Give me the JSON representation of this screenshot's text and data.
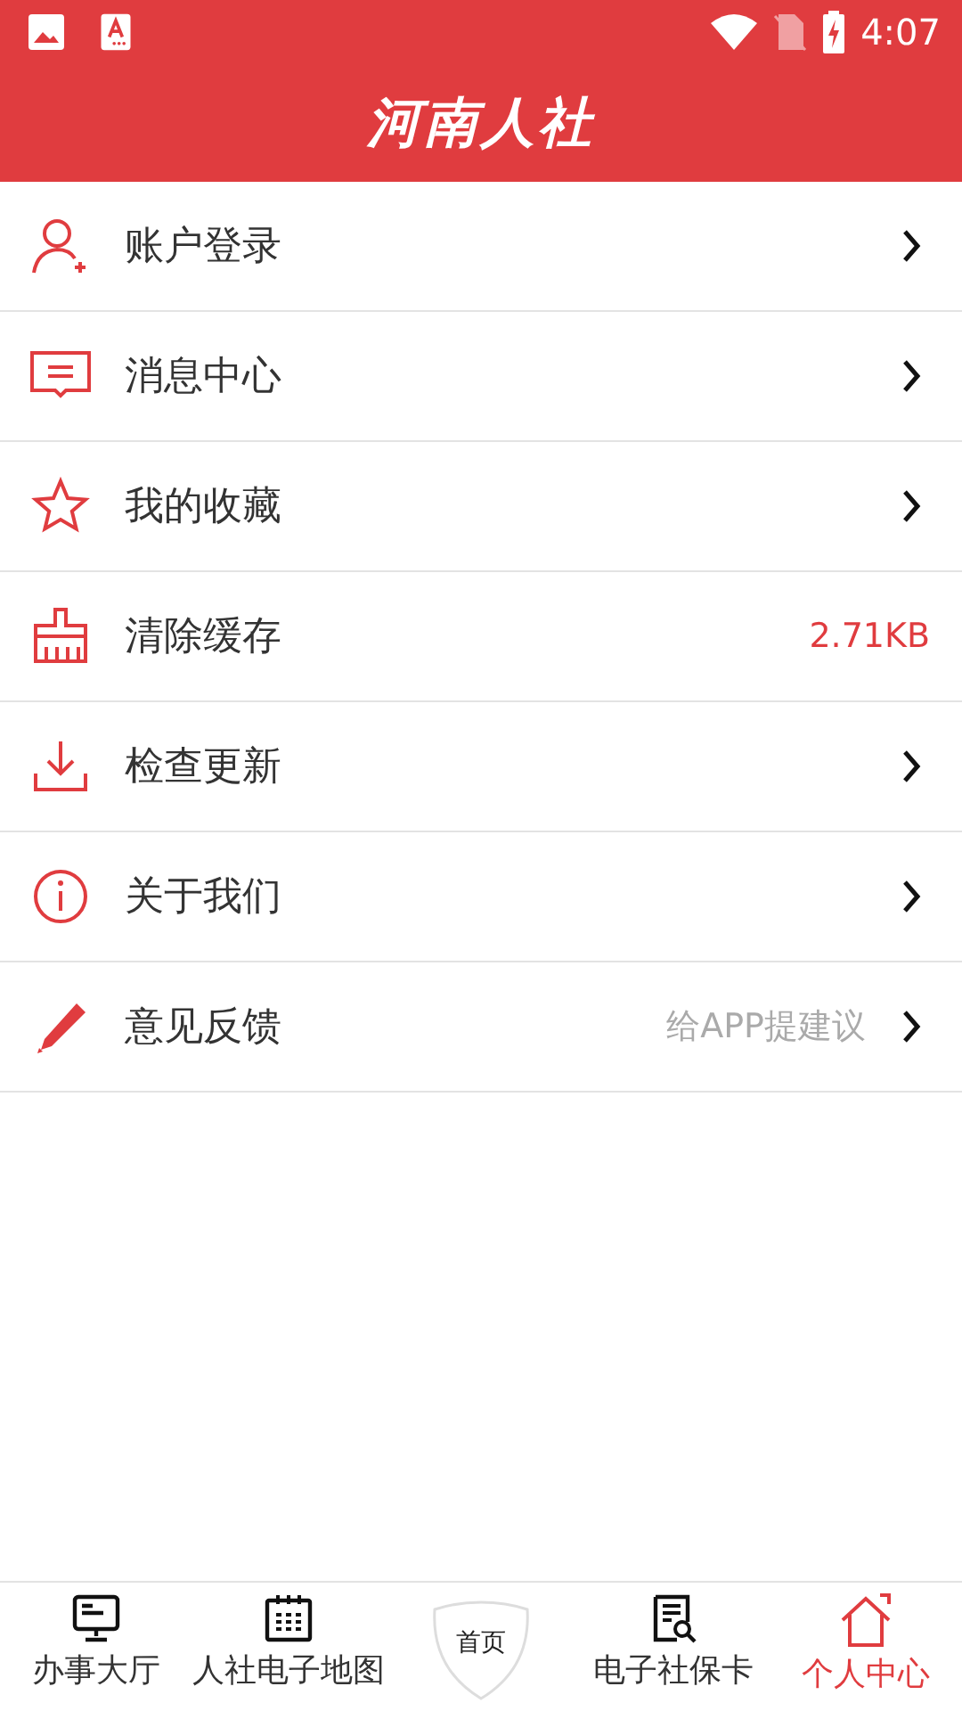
{
  "status_bar": {
    "time": "4:07"
  },
  "header": {
    "title": "河南人社"
  },
  "menu": [
    {
      "label": "账户登录",
      "kind": "link"
    },
    {
      "label": "消息中心",
      "kind": "link"
    },
    {
      "label": "我的收藏",
      "kind": "link"
    },
    {
      "label": "清除缓存",
      "kind": "value",
      "value": "2.71KB"
    },
    {
      "label": "检查更新",
      "kind": "link"
    },
    {
      "label": "关于我们",
      "kind": "link"
    },
    {
      "label": "意见反馈",
      "kind": "hint",
      "value": "给APP提建议"
    }
  ],
  "tabs": [
    {
      "label": "办事大厅",
      "kind": "tab",
      "selected": false
    },
    {
      "label": "人社电子地图",
      "kind": "tab",
      "selected": false
    },
    {
      "label": "首页",
      "kind": "center",
      "selected": false
    },
    {
      "label": "电子社保卡",
      "kind": "tab",
      "selected": false
    },
    {
      "label": "个人中心",
      "kind": "tab",
      "selected": true
    }
  ]
}
